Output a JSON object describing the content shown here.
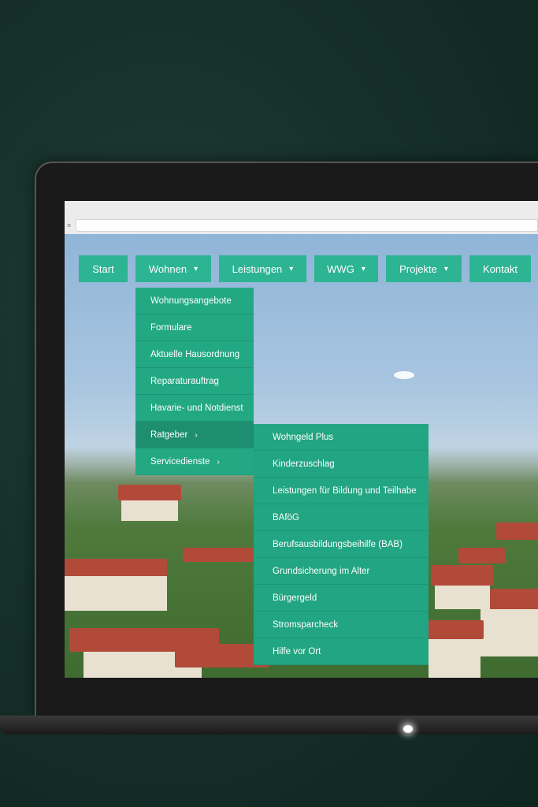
{
  "nav": {
    "items": [
      {
        "label": "Start",
        "has_dropdown": false
      },
      {
        "label": "Wohnen",
        "has_dropdown": true
      },
      {
        "label": "Leistungen",
        "has_dropdown": true
      },
      {
        "label": "WWG",
        "has_dropdown": true
      },
      {
        "label": "Projekte",
        "has_dropdown": true
      },
      {
        "label": "Kontakt",
        "has_dropdown": false
      }
    ],
    "chevron": "▾"
  },
  "wohnen_menu": {
    "items": [
      "Wohnungsangebote",
      "Formulare",
      "Aktuelle Hausordnung",
      "Reparaturauftrag",
      "Havarie- und Notdienst",
      "Ratgeber",
      "Servicedienste"
    ],
    "active": "Ratgeber",
    "submenu_arrow": "›"
  },
  "ratgeber_submenu": {
    "items": [
      "Wohngeld Plus",
      "Kinderzuschlag",
      "Leistungen für Bildung und Teilhabe",
      "BAföG",
      "Berufsausbildungsbeihilfe (BAB)",
      "Grundsicherung im Alter",
      "Bürgergeld",
      "Stromsparcheck",
      "Hilfe vor Ort"
    ]
  },
  "colors": {
    "accent": "#2db493",
    "menu_bg": "#23a884",
    "menu_active": "#1d8f70"
  },
  "browser": {
    "menu_icon": "≡"
  }
}
